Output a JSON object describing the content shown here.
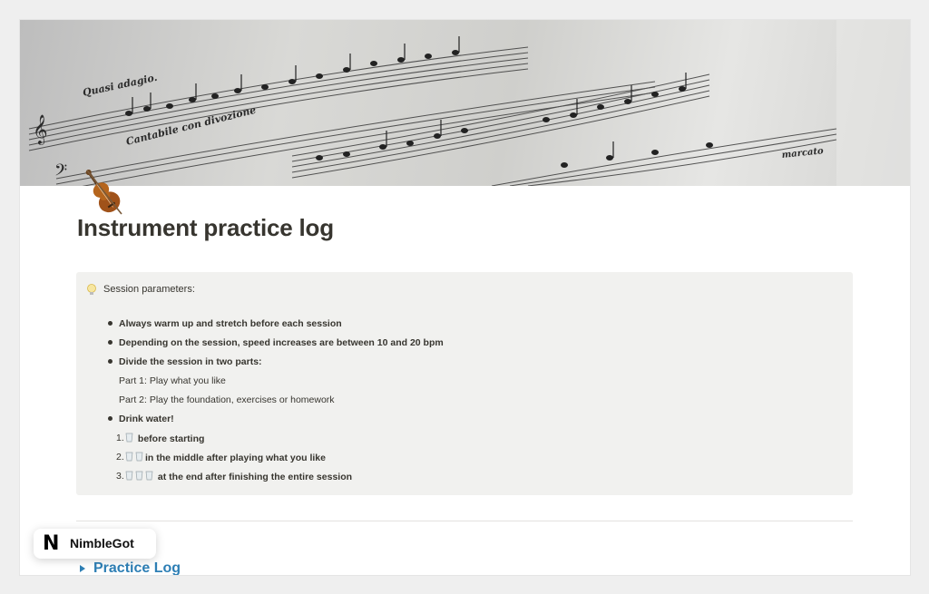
{
  "page": {
    "title": "Instrument practice log",
    "page_icon": "violin-icon",
    "cover": "sheet-music-cover"
  },
  "callout": {
    "icon": "lightbulb-icon",
    "title": "Session parameters:",
    "bullets": [
      "Always warm up and stretch before each session",
      "Depending on the session, speed increases are between 10 and 20 bpm",
      "Divide the session in two parts:",
      "Drink water!"
    ],
    "sub_lines": [
      "Part 1:  Play what you like",
      "Part 2: Play the foundation, exercises or homework"
    ],
    "numbered": [
      {
        "marker": "1.",
        "cups": 1,
        "text": " before starting"
      },
      {
        "marker": "2.",
        "cups": 2,
        "text": "in the middle after playing what you like"
      },
      {
        "marker": "3.",
        "cups": 3,
        "text": " at the end after finishing the entire session"
      }
    ]
  },
  "toggle": {
    "label": "Practice Log"
  },
  "badge": {
    "logo": "N",
    "text": "NimbleGot"
  },
  "colors": {
    "background": "#efefef",
    "callout_bg": "#f1f1ef",
    "text": "#37352f",
    "link_blue": "#2e7fb5"
  }
}
